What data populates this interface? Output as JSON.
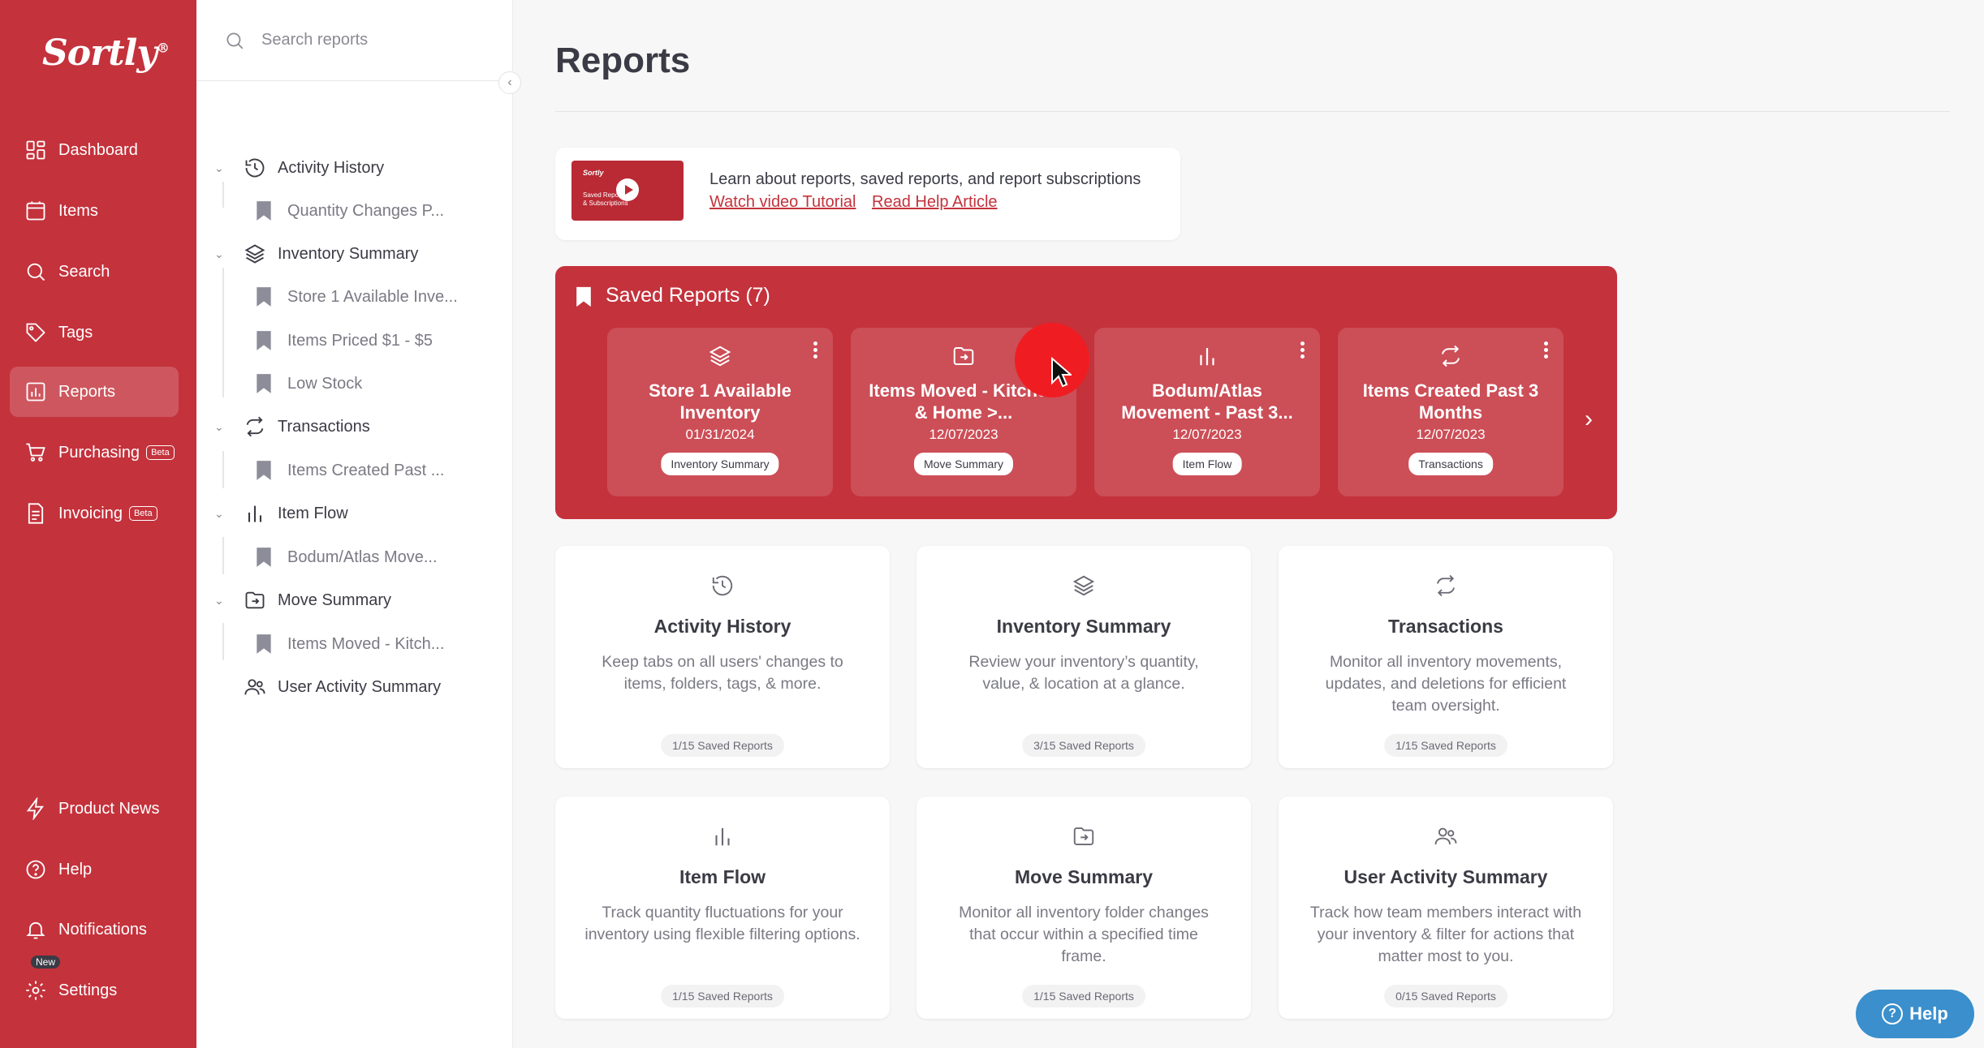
{
  "nav": {
    "logo": "Sortly",
    "logo_mark": "®",
    "items": [
      {
        "label": "Dashboard",
        "icon": "dashboard-icon"
      },
      {
        "label": "Items",
        "icon": "items-icon"
      },
      {
        "label": "Search",
        "icon": "search-icon"
      },
      {
        "label": "Tags",
        "icon": "tag-icon"
      },
      {
        "label": "Reports",
        "icon": "reports-icon",
        "active": true
      },
      {
        "label": "Purchasing",
        "icon": "cart-icon",
        "badge": "Beta"
      },
      {
        "label": "Invoicing",
        "icon": "invoice-icon",
        "badge": "Beta"
      }
    ],
    "bottom": [
      {
        "label": "Product News",
        "icon": "bolt-icon"
      },
      {
        "label": "Help",
        "icon": "help-icon"
      },
      {
        "label": "Notifications",
        "icon": "bell-icon"
      },
      {
        "label": "Settings",
        "icon": "gear-icon",
        "badge": "New"
      }
    ]
  },
  "tree": {
    "search_placeholder": "Search reports",
    "groups": [
      {
        "label": "Activity History",
        "children": [
          "Quantity Changes P..."
        ]
      },
      {
        "label": "Inventory Summary",
        "children": [
          "Store 1 Available Inve...",
          "Items Priced $1 - $5",
          "Low Stock"
        ]
      },
      {
        "label": "Transactions",
        "children": [
          "Items Created Past ..."
        ]
      },
      {
        "label": "Item Flow",
        "children": [
          "Bodum/Atlas Move..."
        ]
      },
      {
        "label": "Move Summary",
        "children": [
          "Items Moved - Kitch..."
        ]
      },
      {
        "label": "User Activity Summary",
        "children": []
      }
    ]
  },
  "main": {
    "title": "Reports",
    "tutorial": {
      "thumb_brand": "Sortly",
      "thumb_caption": "Saved Reports & Subscriptions",
      "text": "Learn about reports, saved reports, and report subscriptions",
      "video_link": "Watch video Tutorial",
      "article_link": "Read Help Article"
    },
    "saved": {
      "title": "Saved Reports (7)",
      "cards": [
        {
          "name": "Store 1 Available Inventory",
          "date": "01/31/2024",
          "tag": "Inventory Summary",
          "icon": "layers-icon"
        },
        {
          "name": "Items Moved - Kitchen & Home >...",
          "date": "12/07/2023",
          "tag": "Move Summary",
          "icon": "move-icon"
        },
        {
          "name": "Bodum/Atlas Movement - Past 3...",
          "date": "12/07/2023",
          "tag": "Item Flow",
          "icon": "bar-chart-icon"
        },
        {
          "name": "Items Created Past 3 Months",
          "date": "12/07/2023",
          "tag": "Transactions",
          "icon": "transactions-icon"
        }
      ]
    },
    "report_types": [
      {
        "name": "Activity History",
        "desc": "Keep tabs on all users' changes to items, folders, tags, & more.",
        "count": "1/15 Saved Reports",
        "icon": "history-icon"
      },
      {
        "name": "Inventory Summary",
        "desc": "Review your inventory’s quantity, value, & location at a glance.",
        "count": "3/15 Saved Reports",
        "icon": "layers-icon"
      },
      {
        "name": "Transactions",
        "desc": "Monitor all inventory movements, updates, and deletions for efficient team oversight.",
        "count": "1/15 Saved Reports",
        "icon": "transactions-icon"
      },
      {
        "name": "Item Flow",
        "desc": "Track quantity fluctuations for your inventory using flexible filtering options.",
        "count": "1/15 Saved Reports",
        "icon": "bar-chart-icon"
      },
      {
        "name": "Move Summary",
        "desc": "Monitor all inventory folder changes that occur within a specified time frame.",
        "count": "1/15 Saved Reports",
        "icon": "move-icon"
      },
      {
        "name": "User Activity Summary",
        "desc": "Track how team members interact with your inventory & filter for actions that matter most to you.",
        "count": "0/15 Saved Reports",
        "icon": "users-icon"
      }
    ],
    "help_button": "Help"
  },
  "colors": {
    "brand": "#c4323c",
    "help": "#3a8fcc",
    "cursor_highlight": "#ef1d22"
  }
}
